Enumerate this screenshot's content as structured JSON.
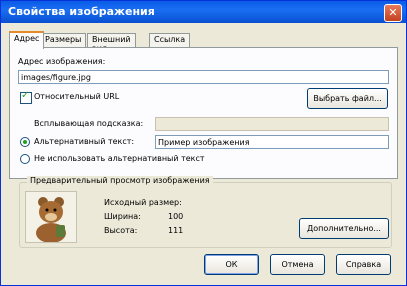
{
  "window": {
    "title": "Свойства изображения",
    "close_glyph": "✕"
  },
  "tabs": [
    {
      "label": "Адрес",
      "active": true
    },
    {
      "label": "Размеры"
    },
    {
      "label": "Внешний вид"
    },
    {
      "label": "Ссылка"
    }
  ],
  "address": {
    "label": "Адрес изображения:",
    "value": "images/figure.jpg",
    "relative_url_label": "Относительный URL",
    "relative_url_checked": true,
    "choose_file_label": "Выбрать файл..."
  },
  "tooltip": {
    "label": "Всплывающая подсказка:",
    "value": ""
  },
  "alt": {
    "alt_text_label": "Альтернативный текст:",
    "alt_text_value": "Пример изображения",
    "alt_text_selected": true,
    "no_alt_label": "Не использовать альтернативный текст"
  },
  "preview": {
    "group_title": "Предварительный просмотр изображения",
    "original_size_label": "Исходный размер:",
    "width_label": "Ширина:",
    "width_value": "100",
    "height_label": "Высота:",
    "height_value": "111",
    "advanced_label": "Дополнительно..."
  },
  "footer": {
    "ok_label": "ОК",
    "cancel_label": "Отмена",
    "help_label": "Справка"
  },
  "colors": {
    "titlebar": "#0a5ce6",
    "face": "#ece9d8",
    "accent_tab": "#e68b2c",
    "check": "#21a121"
  }
}
